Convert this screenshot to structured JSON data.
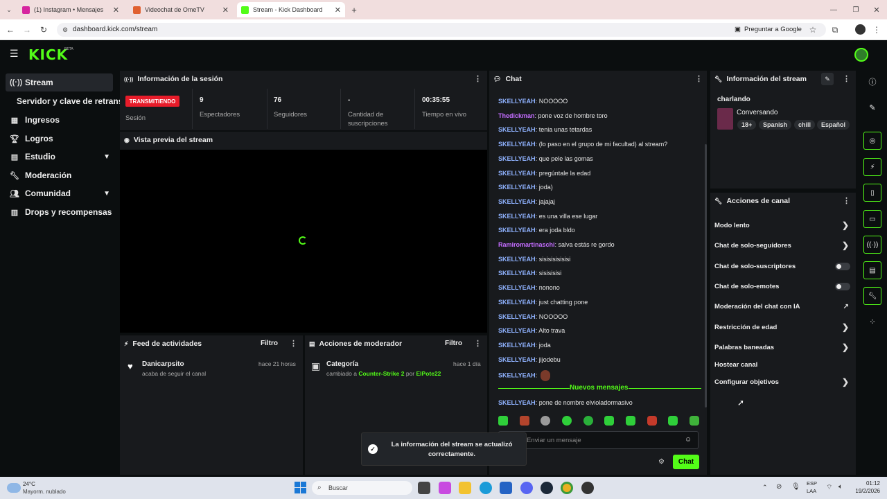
{
  "browser": {
    "tabs": [
      {
        "label": "(1) Instagram • Mensajes",
        "color": "#d6249f"
      },
      {
        "label": "Videochat de OmeTV",
        "color": "#e06030"
      },
      {
        "label": "Stream - Kick Dashboard",
        "color": "#53fc18"
      }
    ],
    "url": "dashboard.kick.com/stream",
    "ask_google": "Preguntar a Google"
  },
  "brand": {
    "logo": "KICK",
    "beta": "BETA",
    "accent": "#53fc18"
  },
  "sidebar": {
    "items": [
      {
        "label": "Stream",
        "icon": "broadcast-icon"
      },
      {
        "label": "Servidor y clave de retransmisión",
        "icon": ""
      },
      {
        "label": "Ingresos",
        "icon": "chart-icon"
      },
      {
        "label": "Logros",
        "icon": "trophy-icon"
      },
      {
        "label": "Estudio",
        "icon": "studio-icon"
      },
      {
        "label": "Moderación",
        "icon": "wrench-icon"
      },
      {
        "label": "Comunidad",
        "icon": "community-icon"
      },
      {
        "label": "Drops y recompensas",
        "icon": "drops-icon"
      }
    ]
  },
  "session": {
    "title": "Información de la sesión",
    "badge": "TRANSMITIENDO",
    "badge_label": "Sesión",
    "stats": [
      {
        "value": "9",
        "label": "Espectadores"
      },
      {
        "value": "76",
        "label": "Seguidores"
      },
      {
        "value": "-",
        "label": "Cantidad de suscripciones"
      },
      {
        "value": "00:35:55",
        "label": "Tiempo en vivo"
      }
    ]
  },
  "preview": {
    "title": "Vista previa del stream"
  },
  "activity": {
    "title": "Feed de actividades",
    "filter": "Filtro",
    "item": {
      "user": "Danicarpsito",
      "text": "acaba de seguir el canal",
      "time": "hace 21 horas"
    }
  },
  "modactions": {
    "title": "Acciones de moderador",
    "filter": "Filtro",
    "item": {
      "title": "Categoría",
      "prefix": "cambiado a",
      "category": "Counter-Strike 2",
      "by": "por",
      "mod": "ElPote22",
      "time": "hace 1 día"
    }
  },
  "chat": {
    "title": "Chat",
    "messages": [
      {
        "user": "SKELLYEAH",
        "text": "NOOOOO"
      },
      {
        "user": "Thedickman",
        "text": "pone voz de hombre toro",
        "purple": true
      },
      {
        "user": "SKELLYEAH",
        "text": "tenia unas tetardas"
      },
      {
        "user": "SKELLYEAH",
        "text": "(lo paso en el grupo de mi facultad) al stream?"
      },
      {
        "user": "SKELLYEAH",
        "text": "que pele las gomas"
      },
      {
        "user": "SKELLYEAH",
        "text": "pregúntale la edad"
      },
      {
        "user": "SKELLYEAH",
        "text": "joda)"
      },
      {
        "user": "SKELLYEAH",
        "text": "jajajaj"
      },
      {
        "user": "SKELLYEAH",
        "text": "es una villa ese lugar"
      },
      {
        "user": "SKELLYEAH",
        "text": "era joda bldo"
      },
      {
        "user": "Ramiromartinaschi",
        "text": "salva estás re gordo",
        "purple": true
      },
      {
        "user": "SKELLYEAH",
        "text": "sisisisisisisi"
      },
      {
        "user": "SKELLYEAH",
        "text": "sisisisisi"
      },
      {
        "user": "SKELLYEAH",
        "text": "nonono"
      },
      {
        "user": "SKELLYEAH",
        "text": "just chatting pone"
      },
      {
        "user": "SKELLYEAH",
        "text": "NOOOOO"
      },
      {
        "user": "SKELLYEAH",
        "text": "Alto trava"
      },
      {
        "user": "SKELLYEAH",
        "text": "joda"
      },
      {
        "user": "SKELLYEAH",
        "text": "jijodebu"
      },
      {
        "user": "SKELLYEAH",
        "text": ""
      }
    ],
    "new_messages": "Nuevos mensajes",
    "last": {
      "user": "SKELLYEAH",
      "text": "pone de nombre elvioladormasivo"
    },
    "placeholder": "Enviar un mensaje",
    "send": "Chat"
  },
  "toast": {
    "text": "La información del stream se actualizó correctamente."
  },
  "streaminfo": {
    "title": "Información del stream",
    "stream_title": "charlando",
    "category": "Conversando",
    "tags": [
      "18+",
      "Spanish",
      "chill",
      "Español"
    ]
  },
  "channel_actions": {
    "title": "Acciones de canal",
    "items": [
      {
        "label": "Modo lento",
        "type": "arrow"
      },
      {
        "label": "Chat de solo-seguidores",
        "type": "arrow"
      },
      {
        "label": "Chat de solo-suscriptores",
        "type": "toggle"
      },
      {
        "label": "Chat de solo-emotes",
        "type": "toggle"
      },
      {
        "label": "Moderación del chat con IA",
        "type": "external"
      },
      {
        "label": "Restricción de edad",
        "type": "arrow"
      },
      {
        "label": "Palabras baneadas",
        "type": "arrow"
      },
      {
        "label": "Hostear canal",
        "type": "none"
      },
      {
        "label": "Configurar objetivos",
        "type": "arrow"
      }
    ]
  },
  "taskbar": {
    "weather_temp": "24°C",
    "weather_desc": "Mayorm. nublado",
    "search": "Buscar",
    "lang1": "ESP",
    "lang2": "LAA",
    "time": "01:12",
    "date": "19/2/2026"
  }
}
